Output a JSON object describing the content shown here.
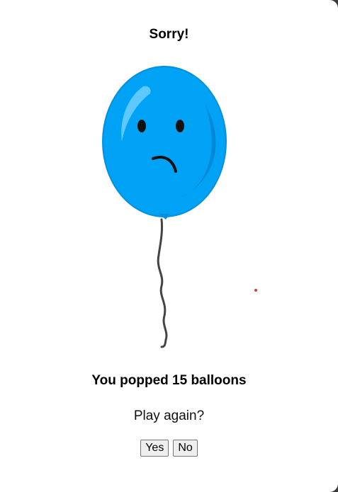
{
  "dialog": {
    "title": "Sorry!",
    "result_text": "You popped 15 balloons",
    "prompt": "Play again?",
    "buttons": {
      "yes_label": "Yes",
      "no_label": "No"
    }
  },
  "balloon": {
    "icon": "sad-balloon-icon",
    "color": "#00A2F5",
    "shade_color": "#0088D8",
    "highlight_color": "#6FD0FF"
  },
  "colors": {
    "background": "#ffffff",
    "text": "#000000",
    "target_dot": "#e53935"
  }
}
